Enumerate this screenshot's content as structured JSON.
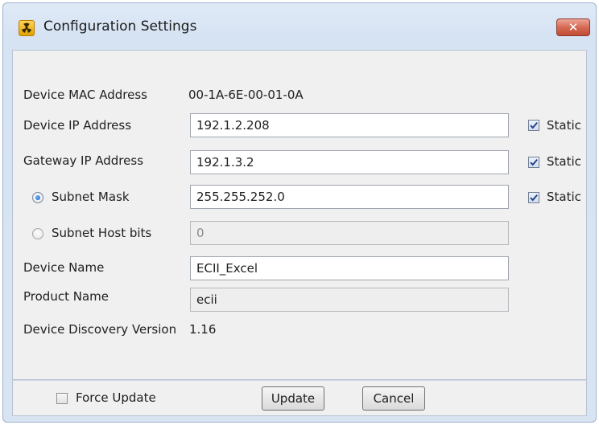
{
  "window": {
    "title": "Configuration Settings",
    "icon": "radiation-icon",
    "close_glyph": "✕"
  },
  "form": {
    "mac": {
      "label": "Device MAC Address",
      "value": "00-1A-6E-00-01-0A"
    },
    "ip": {
      "label": "Device IP Address",
      "value": "192.1.2.208",
      "static_label": "Static",
      "static_checked": true
    },
    "gateway": {
      "label": "Gateway IP Address",
      "value": "192.1.3.2",
      "static_label": "Static",
      "static_checked": true
    },
    "subnet_mask": {
      "label": "Subnet Mask",
      "value": "255.255.252.0",
      "selected": true,
      "static_label": "Static",
      "static_checked": true
    },
    "subnet_host_bits": {
      "label": "Subnet Host bits",
      "value": "0",
      "selected": false,
      "disabled": true
    },
    "device_name": {
      "label": "Device Name",
      "value": "ECII_Excel"
    },
    "product_name": {
      "label": "Product Name",
      "value": "ecii",
      "disabled": true
    },
    "discovery_version": {
      "label": "Device Discovery Version",
      "value": "1.16"
    }
  },
  "footer": {
    "force_update_label": "Force Update",
    "force_update_checked": false,
    "update_label": "Update",
    "cancel_label": "Cancel"
  },
  "colors": {
    "frame": "#d9e4f2",
    "client": "#f0f0f0",
    "close": "#c24b33",
    "check": "#1b3f8a"
  }
}
